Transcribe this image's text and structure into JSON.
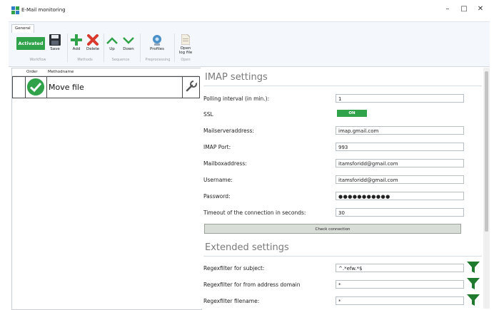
{
  "window": {
    "title": "E-Mail monitoring",
    "minimize": "–",
    "maximize": "□",
    "close": "✕"
  },
  "ribbon": {
    "tab": "General",
    "activated": "Activated",
    "save": "Save",
    "add": "Add",
    "delete": "Delete",
    "up": "Up",
    "down": "Down",
    "profiles": "Profiles",
    "open_log_line1": "Open",
    "open_log_line2": "log file",
    "groups": {
      "workflow": "Workflow",
      "methods": "Methods",
      "sequence": "Sequence",
      "preprocessing": "Preprocessing",
      "open": "Open"
    }
  },
  "methods_list": {
    "col_order": "Order",
    "col_methodname": "Methodname",
    "rows": [
      {
        "name": "Move file"
      }
    ]
  },
  "imap": {
    "heading": "IMAP settings",
    "polling_label": "Polling interval (in min.):",
    "polling_value": "1",
    "ssl_label": "SSL",
    "ssl_value": "ON",
    "server_label": "Mailserveraddress:",
    "server_value": "imap.gmail.com",
    "port_label": "IMAP Port:",
    "port_value": "993",
    "mailbox_label": "Mailboxaddress:",
    "mailbox_value": "itamsforidd@gmail.com",
    "username_label": "Username:",
    "username_value": "itamsforidd@gmail.com",
    "password_label": "Password:",
    "password_value": "●●●●●●●●●●●",
    "timeout_label": "Timeout of the connection in seconds:",
    "timeout_value": "30",
    "check_button": "Check connection"
  },
  "extended": {
    "heading": "Extended settings",
    "subject_label": "Regexfilter for subject:",
    "subject_value": "^.*efw.*$",
    "domain_label": "Regexfilter for from address domain",
    "domain_value": "*",
    "filename_label": "Regexfilter filename:",
    "filename_value": "*"
  },
  "colors": {
    "accent_green": "#2fa24a",
    "funnel_green": "#1f7a2e",
    "delete_red": "#d83a2e"
  }
}
